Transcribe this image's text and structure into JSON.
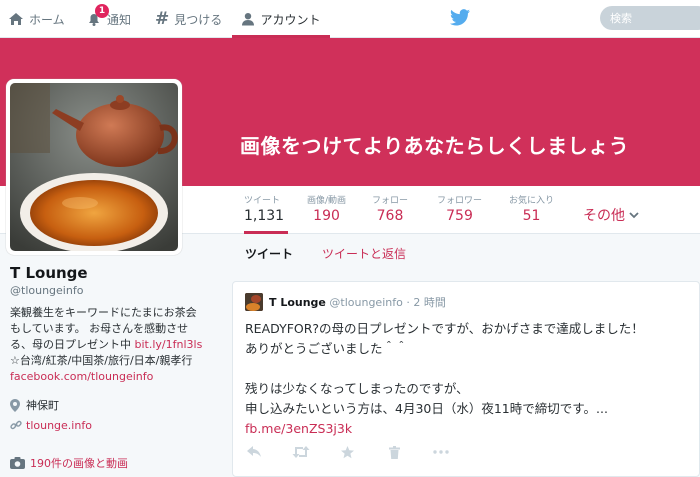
{
  "nav": {
    "home": "ホーム",
    "notifications": "通知",
    "notification_count": "1",
    "discover": "見つける",
    "account": "アカウント",
    "search_placeholder": "検索"
  },
  "banner": {
    "text": "画像をつけてよりあなたらしくしましょう"
  },
  "stats": [
    {
      "label": "ツイート",
      "value": "1,131"
    },
    {
      "label": "画像/動画",
      "value": "190"
    },
    {
      "label": "フォロー",
      "value": "768"
    },
    {
      "label": "フォロワー",
      "value": "759"
    },
    {
      "label": "お気に入り",
      "value": "51"
    }
  ],
  "more_label": "その他",
  "profile": {
    "name": "T Lounge",
    "handle": "@tloungeinfo",
    "bio_lines": [
      "楽観養生をキーワードにたまにお茶会",
      "もしています。 お母さんを感動させ",
      "る、母の日プレゼント中"
    ],
    "bio_link": "bit.ly/1fnl3ls",
    "bio_line4": "☆台湾/紅茶/中国茶/旅行/日本/親孝行",
    "bio_link2": "facebook.com/tloungeinfo",
    "location": "神保町",
    "website": "tlounge.info",
    "media": "190件の画像と動画"
  },
  "tabs": {
    "tweets": "ツイート",
    "replies": "ツイートと返信"
  },
  "tweet": {
    "name": "T Lounge",
    "handle": "@tloungeinfo",
    "time": "· 2 時間",
    "line1": "READYFOR?の母の日プレゼントですが、おかげさまで達成しました！",
    "line2": "ありがとうございました＾＾",
    "line3": "残りは少なくなってしまったのですが、",
    "line4": "申し込みたいという方は、4月30日（水）夜11時で締切です。...",
    "link": "fb.me/3enZS3j3k"
  },
  "colors": {
    "accent": "#c92d55",
    "banner": "#d0305a",
    "twitter_blue": "#55acee"
  }
}
